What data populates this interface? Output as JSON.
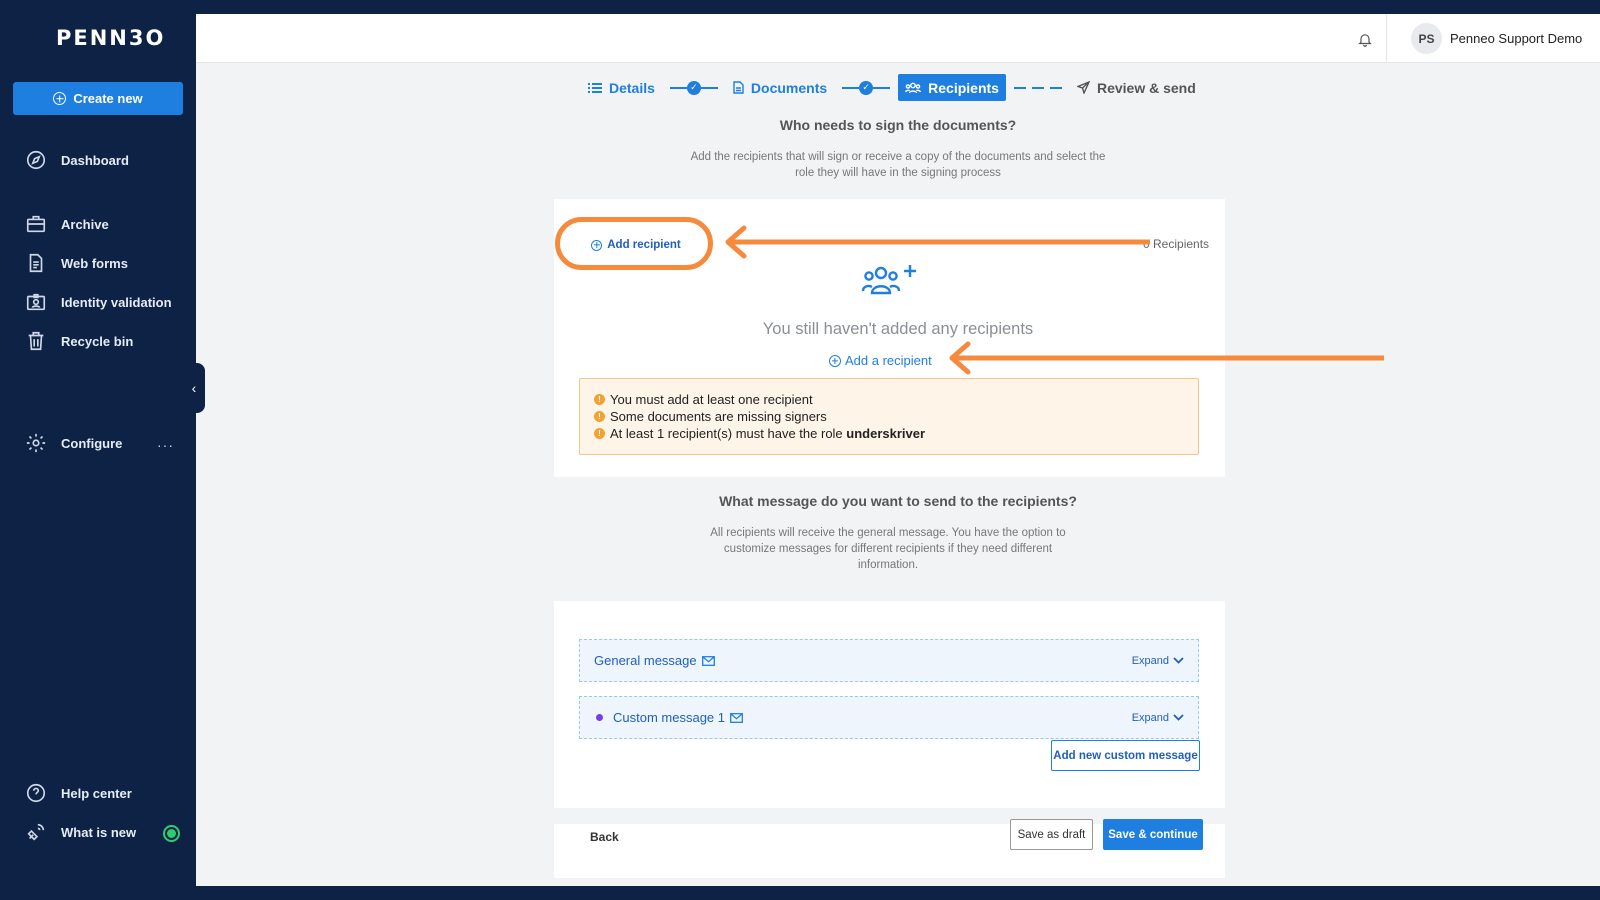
{
  "app": {
    "logo_text": "PENN3O"
  },
  "sidebar": {
    "create_label": "Create new",
    "items": [
      {
        "label": "Dashboard",
        "icon": "compass-icon"
      },
      {
        "label": "Archive",
        "icon": "briefcase-icon"
      },
      {
        "label": "Web forms",
        "icon": "document-icon"
      },
      {
        "label": "Identity validation",
        "icon": "id-badge-icon"
      },
      {
        "label": "Recycle bin",
        "icon": "trash-icon"
      },
      {
        "label": "Configure",
        "icon": "gear-icon"
      },
      {
        "label": "Help center",
        "icon": "question-icon"
      },
      {
        "label": "What is new",
        "icon": "satellite-icon"
      }
    ],
    "more_label": "···",
    "collapse_glyph": "‹"
  },
  "topbar": {
    "avatar_initials": "PS",
    "user_name": "Penneo Support Demo"
  },
  "stepper": {
    "steps": [
      {
        "label": "Details",
        "state": "done"
      },
      {
        "label": "Documents",
        "state": "done"
      },
      {
        "label": "Recipients",
        "state": "active"
      },
      {
        "label": "Review & send",
        "state": "pending"
      }
    ],
    "check_glyph": "✓"
  },
  "recipients": {
    "title": "Who needs to sign the documents?",
    "subtitle": "Add the recipients that will sign or receive a copy of the documents and select the role they will have in the signing process",
    "add_button": "Add recipient",
    "count": "0 Recipients",
    "empty_text": "You still haven't added any recipients",
    "add_link": "Add a recipient",
    "warnings": [
      {
        "text": "You must add at least one recipient",
        "bold": ""
      },
      {
        "text": "Some documents are missing signers",
        "bold": ""
      },
      {
        "text": "At least 1 recipient(s) must have the role ",
        "bold": "underskriver"
      }
    ],
    "warn_glyph": "!"
  },
  "messages": {
    "title": "What message do you want to send to the recipients?",
    "subtitle": "All recipients will receive the general message. You have the option to customize messages for different recipients if they need different information.",
    "rows": [
      {
        "label": "General message",
        "expand": "Expand"
      },
      {
        "label": "Custom message 1",
        "expand": "Expand"
      }
    ],
    "add_custom": "Add new custom message"
  },
  "footer": {
    "back": "Back",
    "save_draft": "Save as draft",
    "save_continue": "Save & continue"
  },
  "colors": {
    "sidebar_bg": "#0d2245",
    "accent": "#1f7fe0",
    "annotation": "#f58a3c",
    "warning_bg": "#fff4e8",
    "custom_dot": "#7a3be8",
    "status_green": "#2ecc71"
  }
}
